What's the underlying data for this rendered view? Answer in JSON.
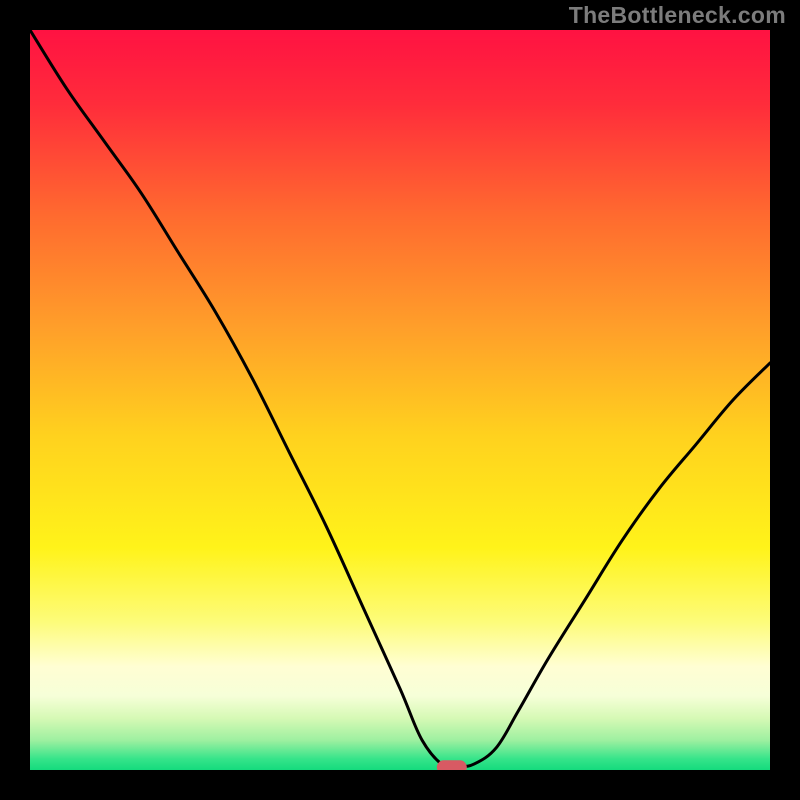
{
  "watermark": "TheBottleneck.com",
  "chart_data": {
    "type": "line",
    "title": "",
    "xlabel": "",
    "ylabel": "",
    "xlim": [
      0,
      100
    ],
    "ylim": [
      0,
      100
    ],
    "x": [
      0,
      5,
      10,
      15,
      20,
      25,
      30,
      35,
      40,
      45,
      50,
      53,
      56,
      58,
      60,
      63,
      66,
      70,
      75,
      80,
      85,
      90,
      95,
      100
    ],
    "values": [
      100,
      92,
      85,
      78,
      70,
      62,
      53,
      43,
      33,
      22,
      11,
      4,
      0.5,
      0.5,
      0.8,
      3,
      8,
      15,
      23,
      31,
      38,
      44,
      50,
      55
    ],
    "marker": {
      "x": 57,
      "y": 0.5
    },
    "gradient_stops": [
      {
        "offset": 0.0,
        "color": "#ff1242"
      },
      {
        "offset": 0.1,
        "color": "#ff2c3b"
      },
      {
        "offset": 0.25,
        "color": "#ff6a2f"
      },
      {
        "offset": 0.4,
        "color": "#ff9e2a"
      },
      {
        "offset": 0.55,
        "color": "#ffd21e"
      },
      {
        "offset": 0.7,
        "color": "#fff31a"
      },
      {
        "offset": 0.8,
        "color": "#fdfc7a"
      },
      {
        "offset": 0.86,
        "color": "#fffed3"
      },
      {
        "offset": 0.9,
        "color": "#f6ffd8"
      },
      {
        "offset": 0.93,
        "color": "#d6f9b5"
      },
      {
        "offset": 0.96,
        "color": "#9df0a0"
      },
      {
        "offset": 0.985,
        "color": "#36e48a"
      },
      {
        "offset": 1.0,
        "color": "#14db7d"
      }
    ]
  }
}
